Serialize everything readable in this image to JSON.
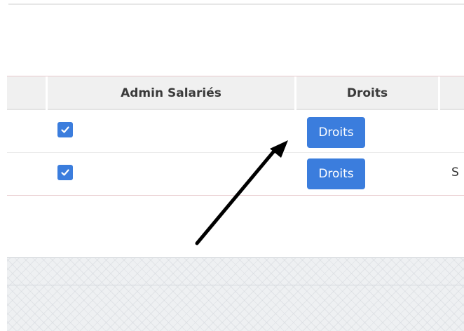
{
  "table": {
    "columns": [
      "",
      "Admin Salariés",
      "Droits",
      ""
    ],
    "rows": [
      {
        "admin_salaries_checked": true,
        "droits_button": "Droits",
        "next_cell_text": ""
      },
      {
        "admin_salaries_checked": true,
        "droits_button": "Droits",
        "next_cell_text": "S"
      }
    ]
  },
  "annotation": {
    "arrow_target": "droits-button"
  },
  "colors": {
    "accent": "#3b7ddd",
    "header_bg": "#f0f0f0",
    "table_border": "#e8c9cc",
    "arrow": "#000000"
  },
  "icons": {
    "checkbox_checked": "checkmark-icon"
  }
}
